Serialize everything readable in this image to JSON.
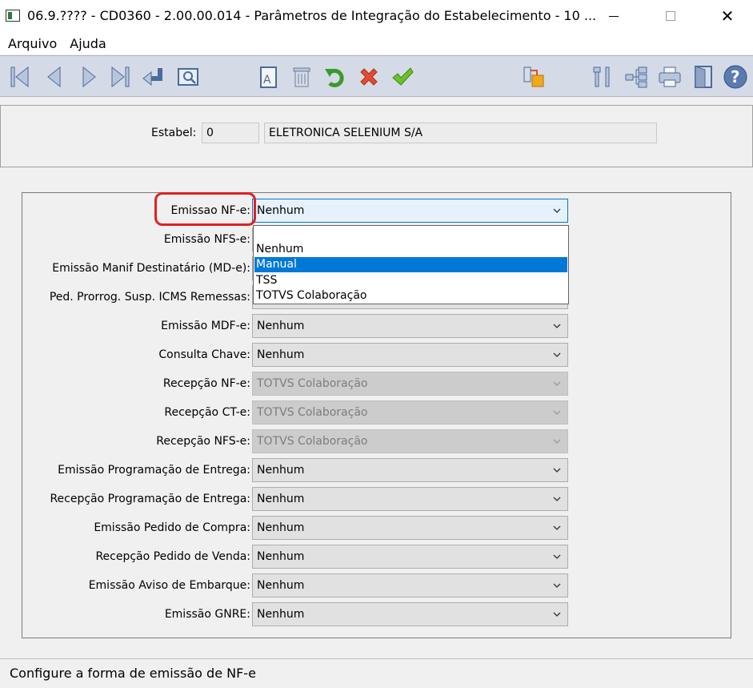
{
  "window": {
    "title": "06.9.???? - CD0360 - 2.00.00.014 - Parâmetros de Integração do Estabelecimento - 10 ..."
  },
  "menu": [
    "Arquivo",
    "Ajuda"
  ],
  "toolbar": {
    "icons": [
      "first-record-icon",
      "previous-record-icon",
      "next-record-icon",
      "last-record-icon",
      "goto-icon",
      "search-zoom-icon",
      "edit-icon",
      "delete-icon",
      "undo-icon",
      "cancel-icon",
      "confirm-icon",
      "integration-icon",
      "tools-icon",
      "hierarchy-icon",
      "print-icon",
      "exit-icon",
      "help-icon"
    ]
  },
  "header": {
    "estab_label": "Estabel:",
    "estab_code": "0",
    "estab_name": "ELETRONICA SELENIUM S/A"
  },
  "fields": [
    {
      "label": "Emissao NF-e:",
      "value": "Nenhum",
      "state": "open"
    },
    {
      "label": "Emissão NFS-e:",
      "value": "",
      "state": "normal"
    },
    {
      "label": "Emissão Manif Destinatário (MD-e):",
      "value": "",
      "state": "normal"
    },
    {
      "label": "Ped. Prorrog. Susp. ICMS Remessas:",
      "value": "",
      "state": "normal"
    },
    {
      "label": "Emissão MDF-e:",
      "value": "Nenhum",
      "state": "normal"
    },
    {
      "label": "Consulta Chave:",
      "value": "Nenhum",
      "state": "normal"
    },
    {
      "label": "Recepção NF-e:",
      "value": "TOTVS Colaboração",
      "state": "disabled"
    },
    {
      "label": "Recepção CT-e:",
      "value": "TOTVS Colaboração",
      "state": "disabled"
    },
    {
      "label": "Recepção NFS-e:",
      "value": "TOTVS Colaboração",
      "state": "disabled"
    },
    {
      "label": "Emissão Programação de Entrega:",
      "value": "Nenhum",
      "state": "normal"
    },
    {
      "label": "Recepção Programação de Entrega:",
      "value": "Nenhum",
      "state": "normal"
    },
    {
      "label": "Emissão Pedido de Compra:",
      "value": "Nenhum",
      "state": "normal"
    },
    {
      "label": "Recepção Pedido de Venda:",
      "value": "Nenhum",
      "state": "normal"
    },
    {
      "label": "Emissão Aviso de Embarque:",
      "value": "Nenhum",
      "state": "normal"
    },
    {
      "label": "Emissão GNRE:",
      "value": "Nenhum",
      "state": "normal"
    }
  ],
  "dropdown": {
    "options": [
      "Nenhum",
      "Manual",
      "TSS",
      "TOTVS Colaboração"
    ],
    "highlighted": "Manual"
  },
  "status": {
    "text": "Configure a forma de emissão de NF-e"
  },
  "colors": {
    "selection": "#0078d7",
    "highlight_ring": "#e02020",
    "toolbar_bg": "#d4dae6"
  }
}
